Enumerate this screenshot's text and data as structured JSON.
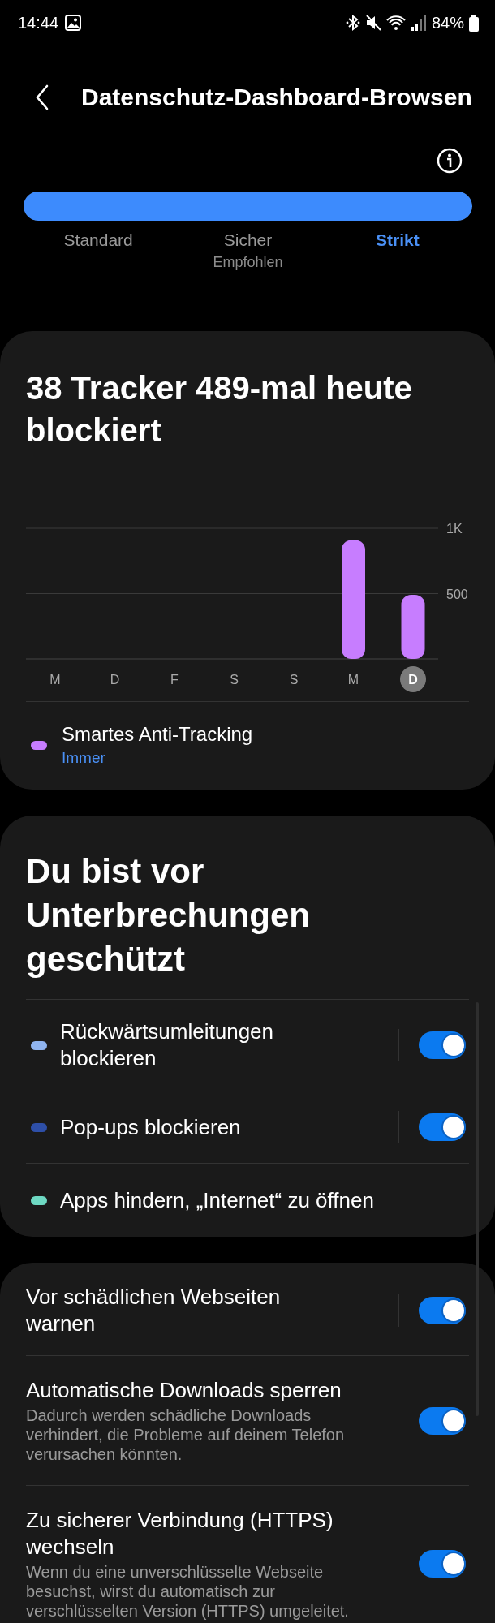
{
  "status_bar": {
    "time": "14:44",
    "battery": "84%"
  },
  "header": {
    "title": "Datenschutz-Dashboard-Browsen"
  },
  "protection_level": {
    "level": 1,
    "options": [
      {
        "label": "Standard",
        "selected": false
      },
      {
        "label": "Sicher",
        "sublabel": "Empfohlen",
        "selected": false
      },
      {
        "label": "Strikt",
        "selected": true
      }
    ]
  },
  "tracker_card": {
    "title": "38 Tracker 489-mal heute blockiert",
    "chart_data": {
      "type": "bar",
      "categories": [
        "M",
        "D",
        "F",
        "S",
        "S",
        "M",
        "D"
      ],
      "series": [
        {
          "name": "Smartes Anti-Tracking",
          "color": "#c77dff",
          "values": [
            0,
            0,
            0,
            0,
            0,
            910,
            490
          ]
        }
      ],
      "ylim": [
        0,
        1000
      ],
      "yticks": [
        {
          "value": 500,
          "label": "500"
        },
        {
          "value": 1000,
          "label": "1K"
        }
      ]
    },
    "days": [
      {
        "selected": false
      },
      {
        "selected": false
      },
      {
        "selected": false
      },
      {
        "selected": false
      },
      {
        "selected": false
      },
      {
        "selected": false
      },
      {
        "selected": true
      }
    ],
    "legend": [
      {
        "value": "Immer"
      }
    ]
  },
  "interruptions_card": {
    "title": "Du bist vor Unterbrechungen geschützt",
    "rows": [
      {
        "kind": "switch",
        "label": "Rückwärtsumleitungen blockieren",
        "color": "#8fb4f0",
        "on": true
      },
      {
        "kind": "switch",
        "label": "Pop-ups blockieren",
        "color": "#2e4fa8",
        "on": true
      },
      {
        "kind": "plain",
        "label": "Apps hindern, „Internet“ zu öffnen",
        "color": "#6ed9c3"
      }
    ]
  },
  "security_card": {
    "rows": [
      {
        "title": "Vor schädlichen Webseiten warnen",
        "separator": true,
        "on": true
      },
      {
        "title": "Automatische Downloads sperren",
        "description": "Dadurch werden schädliche Downloads verhindert, die Probleme auf deinem Telefon verursachen könnten.",
        "separator": false,
        "on": true
      },
      {
        "title": "Zu sicherer Verbindung (HTTPS) wechseln",
        "description": "Wenn du eine unverschlüsselte Webseite besuchst, wirst du automatisch zur verschlüsselten Version (HTTPS) umgeleitet.",
        "separator": false,
        "on": true
      }
    ]
  }
}
